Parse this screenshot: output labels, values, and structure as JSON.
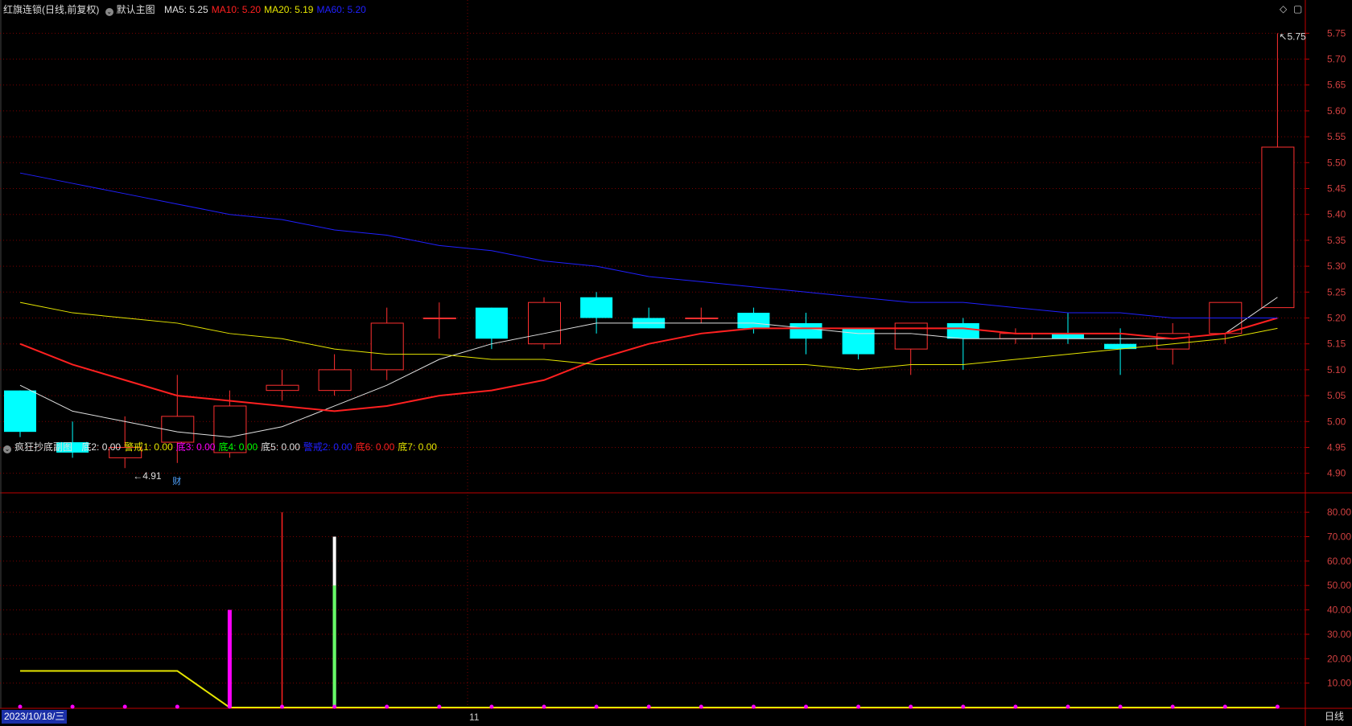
{
  "main_header": {
    "title": "红旗连锁(日线,前复权)",
    "template": "默认主图",
    "ma": [
      {
        "label": "MA5: 5.25",
        "color": "#e0e0e0"
      },
      {
        "label": "MA10: 5.20",
        "color": "#ff2020"
      },
      {
        "label": "MA20: 5.19",
        "color": "#e6e600"
      },
      {
        "label": "MA60: 5.20",
        "color": "#2020ff"
      }
    ]
  },
  "sub_header": {
    "title": "疯狂抄底副图",
    "items": [
      {
        "label": "底2: 0.00",
        "color": "#e0e0e0"
      },
      {
        "label": "警戒1: 0.00",
        "color": "#e6e600"
      },
      {
        "label": "底3: 0.00",
        "color": "#ff00ff"
      },
      {
        "label": "底4: 0.00",
        "color": "#00ff00"
      },
      {
        "label": "底5: 0.00",
        "color": "#e0e0e0"
      },
      {
        "label": "警戒2: 0.00",
        "color": "#2020ff"
      },
      {
        "label": "底6: 0.00",
        "color": "#ff2020"
      },
      {
        "label": "底7: 0.00",
        "color": "#e6e600"
      }
    ]
  },
  "icons": {
    "diamond": "◇",
    "window": "▢"
  },
  "footer": {
    "date": "2023/10/18/三",
    "month_tick": "11",
    "period": "日线"
  },
  "colors": {
    "up": "#ff3030",
    "down": "#00ffff",
    "grid": "#7a0000",
    "axis": "#c00000"
  },
  "chart_data": [
    {
      "type": "candlestick",
      "title": "红旗连锁(日线,前复权)",
      "ylim": [
        4.87,
        5.78
      ],
      "y_ticks": [
        "5.75",
        "5.70",
        "5.65",
        "5.60",
        "5.55",
        "5.50",
        "5.45",
        "5.40",
        "5.35",
        "5.30",
        "5.25",
        "5.20",
        "5.15",
        "5.10",
        "5.05",
        "5.00",
        "4.95",
        "4.90"
      ],
      "candles": [
        {
          "o": 5.06,
          "h": 5.06,
          "l": 4.97,
          "c": 4.98
        },
        {
          "o": 4.96,
          "h": 5.0,
          "l": 4.93,
          "c": 4.94
        },
        {
          "o": 4.93,
          "h": 5.01,
          "l": 4.91,
          "c": 4.95
        },
        {
          "o": 4.96,
          "h": 5.09,
          "l": 4.92,
          "c": 5.01
        },
        {
          "o": 4.94,
          "h": 5.06,
          "l": 4.93,
          "c": 5.03
        },
        {
          "o": 5.06,
          "h": 5.1,
          "l": 5.04,
          "c": 5.07
        },
        {
          "o": 5.06,
          "h": 5.13,
          "l": 5.05,
          "c": 5.1
        },
        {
          "o": 5.1,
          "h": 5.22,
          "l": 5.08,
          "c": 5.19
        },
        {
          "o": 5.2,
          "h": 5.23,
          "l": 5.16,
          "c": 5.2
        },
        {
          "o": 5.22,
          "h": 5.22,
          "l": 5.14,
          "c": 5.16
        },
        {
          "o": 5.15,
          "h": 5.24,
          "l": 5.14,
          "c": 5.23
        },
        {
          "o": 5.24,
          "h": 5.25,
          "l": 5.17,
          "c": 5.2
        },
        {
          "o": 5.2,
          "h": 5.22,
          "l": 5.18,
          "c": 5.18
        },
        {
          "o": 5.2,
          "h": 5.22,
          "l": 5.19,
          "c": 5.2
        },
        {
          "o": 5.21,
          "h": 5.22,
          "l": 5.17,
          "c": 5.18
        },
        {
          "o": 5.19,
          "h": 5.21,
          "l": 5.13,
          "c": 5.16
        },
        {
          "o": 5.18,
          "h": 5.18,
          "l": 5.12,
          "c": 5.13
        },
        {
          "o": 5.14,
          "h": 5.19,
          "l": 5.09,
          "c": 5.19
        },
        {
          "o": 5.19,
          "h": 5.2,
          "l": 5.1,
          "c": 5.16
        },
        {
          "o": 5.16,
          "h": 5.18,
          "l": 5.15,
          "c": 5.17
        },
        {
          "o": 5.17,
          "h": 5.21,
          "l": 5.15,
          "c": 5.16
        },
        {
          "o": 5.15,
          "h": 5.18,
          "l": 5.09,
          "c": 5.14
        },
        {
          "o": 5.14,
          "h": 5.19,
          "l": 5.11,
          "c": 5.17
        },
        {
          "o": 5.17,
          "h": 5.23,
          "l": 5.15,
          "c": 5.23
        },
        {
          "o": 5.22,
          "h": 5.75,
          "l": 5.22,
          "c": 5.53
        }
      ],
      "series": [
        {
          "name": "MA5",
          "color": "#e0e0e0",
          "width": 1,
          "values": [
            5.07,
            5.02,
            5.0,
            4.98,
            4.97,
            4.99,
            5.03,
            5.07,
            5.12,
            5.15,
            5.17,
            5.19,
            5.19,
            5.19,
            5.19,
            5.18,
            5.17,
            5.17,
            5.16,
            5.16,
            5.16,
            5.16,
            5.16,
            5.17,
            5.24
          ]
        },
        {
          "name": "MA10",
          "color": "#ff2020",
          "width": 2,
          "values": [
            5.15,
            5.11,
            5.08,
            5.05,
            5.04,
            5.03,
            5.02,
            5.03,
            5.05,
            5.06,
            5.08,
            5.12,
            5.15,
            5.17,
            5.18,
            5.18,
            5.18,
            5.18,
            5.18,
            5.17,
            5.17,
            5.17,
            5.16,
            5.17,
            5.2
          ]
        },
        {
          "name": "MA20",
          "color": "#e6e600",
          "width": 1,
          "values": [
            5.23,
            5.21,
            5.2,
            5.19,
            5.17,
            5.16,
            5.14,
            5.13,
            5.13,
            5.12,
            5.12,
            5.11,
            5.11,
            5.11,
            5.11,
            5.11,
            5.1,
            5.11,
            5.11,
            5.12,
            5.13,
            5.14,
            5.15,
            5.16,
            5.18
          ]
        },
        {
          "name": "MA60",
          "color": "#2020ff",
          "width": 1,
          "values": [
            5.48,
            5.46,
            5.44,
            5.42,
            5.4,
            5.39,
            5.37,
            5.36,
            5.34,
            5.33,
            5.31,
            5.3,
            5.28,
            5.27,
            5.26,
            5.25,
            5.24,
            5.23,
            5.23,
            5.22,
            5.21,
            5.21,
            5.2,
            5.2,
            5.2
          ]
        }
      ],
      "annotations": [
        {
          "index": 2,
          "value": 4.91,
          "label": "4.91",
          "side": "low"
        },
        {
          "index": 24,
          "value": 5.75,
          "label": "5.75",
          "side": "high"
        },
        {
          "index": 3,
          "label": "财",
          "side": "below-low"
        }
      ]
    },
    {
      "type": "bar",
      "title": "疯狂抄底副图",
      "ylim": [
        0,
        84
      ],
      "y_ticks": [
        "80.00",
        "70.00",
        "60.00",
        "50.00",
        "40.00",
        "30.00",
        "20.00",
        "10.00"
      ],
      "series": [
        {
          "name": "警戒1",
          "type": "line",
          "color": "#e6e600",
          "values": [
            15,
            15,
            15,
            15,
            0,
            0,
            0,
            0,
            0,
            0,
            0,
            0,
            0,
            0,
            0,
            0,
            0,
            0,
            0,
            0,
            0,
            0,
            0,
            0,
            0
          ]
        },
        {
          "name": "底3",
          "type": "bar",
          "color": "#ff00ff",
          "points": [
            {
              "index": 4,
              "value": 40
            }
          ]
        },
        {
          "name": "底6",
          "type": "bar",
          "color": "#ff2020",
          "points": [
            {
              "index": 5,
              "value": 80
            }
          ]
        },
        {
          "name": "底2",
          "type": "bar",
          "color": "#ffffff",
          "points": [
            {
              "index": 6,
              "value": 70
            }
          ]
        },
        {
          "name": "底4",
          "type": "bar",
          "color": "#66ff66",
          "points": [
            {
              "index": 6,
              "value": 50
            }
          ]
        },
        {
          "name": "底5",
          "type": "dots",
          "color": "#ff00ff",
          "values": [
            0,
            0,
            0,
            0,
            0,
            0,
            0,
            0,
            0,
            0,
            0,
            0,
            0,
            0,
            0,
            0,
            0,
            0,
            0,
            0,
            0,
            0,
            0,
            0,
            0
          ]
        }
      ]
    }
  ]
}
